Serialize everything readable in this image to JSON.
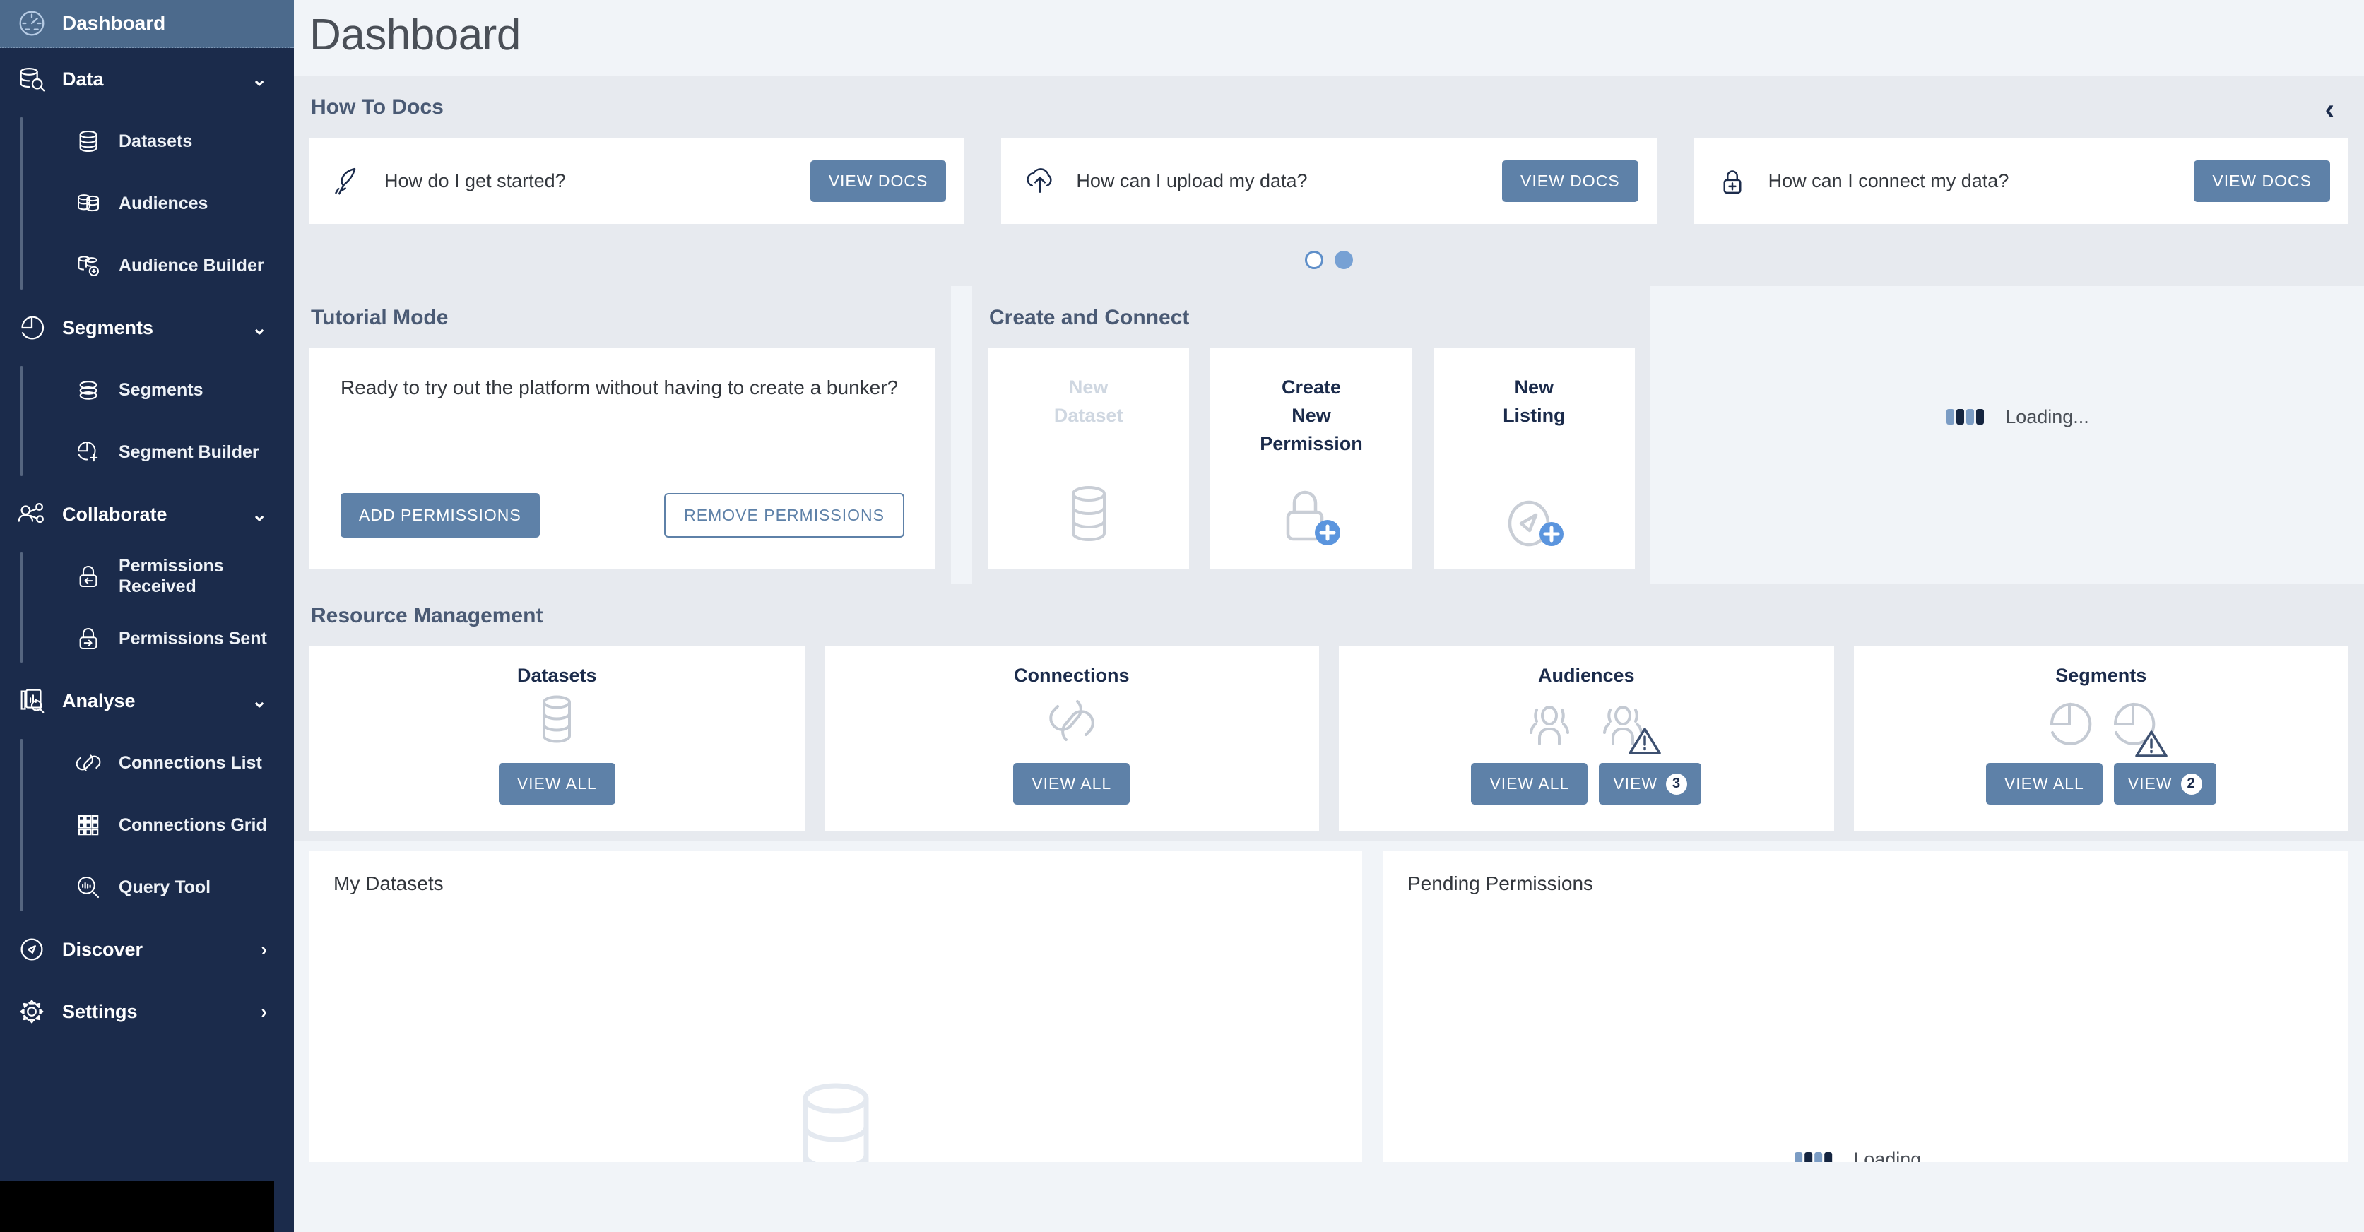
{
  "sidebar": {
    "active": {
      "label": "Dashboard",
      "icon": "gauge-icon"
    },
    "groups": [
      {
        "label": "Data",
        "icon": "data-search-icon",
        "chevron": "⌄",
        "items": [
          {
            "label": "Datasets",
            "icon": "database-icon"
          },
          {
            "label": "Audiences",
            "icon": "audience-icon"
          },
          {
            "label": "Audience Builder",
            "icon": "audience-add-icon"
          }
        ]
      },
      {
        "label": "Segments",
        "icon": "pie-icon",
        "chevron": "⌄",
        "items": [
          {
            "label": "Segments",
            "icon": "segments-stack-icon"
          },
          {
            "label": "Segment Builder",
            "icon": "pie-add-icon"
          }
        ]
      },
      {
        "label": "Collaborate",
        "icon": "share-users-icon",
        "chevron": "⌄",
        "items": [
          {
            "label": "Permissions Received",
            "icon": "lock-in-icon"
          },
          {
            "label": "Permissions Sent",
            "icon": "lock-out-icon"
          }
        ]
      },
      {
        "label": "Analyse",
        "icon": "report-search-icon",
        "chevron": "⌄",
        "items": [
          {
            "label": "Connections List",
            "icon": "links-icon"
          },
          {
            "label": "Connections Grid",
            "icon": "grid-icon"
          },
          {
            "label": "Query Tool",
            "icon": "query-search-icon"
          }
        ]
      }
    ],
    "links": [
      {
        "label": "Discover",
        "icon": "compass-icon",
        "chevron": "›"
      },
      {
        "label": "Settings",
        "icon": "gear-icon",
        "chevron": "›"
      }
    ]
  },
  "page": {
    "title": "Dashboard"
  },
  "how_to_docs": {
    "title": "How To Docs",
    "collapse_icon": "‹",
    "cards": [
      {
        "question": "How do I get started?",
        "button": "VIEW DOCS",
        "icon": "rocket-icon"
      },
      {
        "question": "How can I upload my data?",
        "button": "VIEW DOCS",
        "icon": "cloud-upload-icon"
      },
      {
        "question": "How can I connect my data?",
        "button": "VIEW DOCS",
        "icon": "lock-plus-icon"
      }
    ],
    "carousel": {
      "total": 2,
      "active_index": 1
    }
  },
  "tutorial_mode": {
    "title": "Tutorial Mode",
    "question": "Ready to try out the platform without having to create a bunker?",
    "add_button": "ADD PERMISSIONS",
    "remove_button": "REMOVE PERMISSIONS"
  },
  "create_and_connect": {
    "title": "Create and Connect",
    "cards": [
      {
        "line1": "New",
        "line2": "Dataset",
        "line3": "",
        "icon": "database-icon",
        "disabled": true
      },
      {
        "line1": "Create",
        "line2": "New",
        "line3": "Permission",
        "icon": "lock-plus-icon",
        "disabled": false
      },
      {
        "line1": "New",
        "line2": "Listing",
        "line3": "",
        "icon": "compass-plus-icon",
        "disabled": false
      }
    ]
  },
  "right_loading": {
    "text": "Loading...",
    "icon": "loading-bars-icon"
  },
  "resource_management": {
    "title": "Resource Management",
    "cards": [
      {
        "title": "Datasets",
        "icon": "database-icon",
        "warn": false,
        "buttons": [
          {
            "label": "VIEW ALL",
            "badge": ""
          }
        ]
      },
      {
        "title": "Connections",
        "icon": "links-icon",
        "warn": false,
        "buttons": [
          {
            "label": "VIEW ALL",
            "badge": ""
          }
        ]
      },
      {
        "title": "Audiences",
        "icon": "audience-icon",
        "warn": true,
        "buttons": [
          {
            "label": "VIEW ALL",
            "badge": ""
          },
          {
            "label": "VIEW",
            "badge": "3"
          }
        ]
      },
      {
        "title": "Segments",
        "icon": "pie-icon",
        "warn": true,
        "buttons": [
          {
            "label": "VIEW ALL",
            "badge": ""
          },
          {
            "label": "VIEW",
            "badge": "2"
          }
        ]
      }
    ]
  },
  "bottom": {
    "my_datasets": {
      "title": "My Datasets",
      "icon": "database-ghost-icon"
    },
    "pending_permissions": {
      "title": "Pending Permissions",
      "loading_text": "Loading...",
      "icon": "loading-bars-icon"
    }
  },
  "colors": {
    "sidebar_bg": "#1b2b4b",
    "sidebar_active": "#4c6a8c",
    "accent_blue": "#5e81a8",
    "dot_blue": "#77a1d4",
    "plus_blue": "#5b95de",
    "band_bg": "#e7eaef",
    "page_bg": "#f1f4f8",
    "heading": "#4a5a74",
    "warn": "#3d5070"
  }
}
